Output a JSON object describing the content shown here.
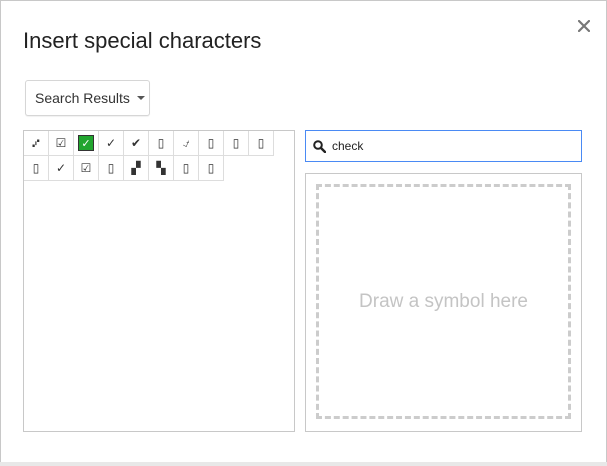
{
  "dialog": {
    "title": "Insert special characters",
    "close_icon": "close-icon"
  },
  "category_dropdown": {
    "selected": "Search Results"
  },
  "search": {
    "value": "check",
    "icon": "search-icon"
  },
  "results": [
    {
      "char": "⑇",
      "name": "partial-check-symbol"
    },
    {
      "char": "☑",
      "name": "ballot-box-with-check"
    },
    {
      "char": "✅",
      "name": "white-heavy-check-mark",
      "style": "green-box"
    },
    {
      "char": "✓",
      "name": "check-mark"
    },
    {
      "char": "✔",
      "name": "heavy-check-mark"
    },
    {
      "char": "▯",
      "name": "unknown-glyph"
    },
    {
      "char": "⍻",
      "name": "not-check-mark"
    },
    {
      "char": "▯",
      "name": "unknown-glyph"
    },
    {
      "char": "▯",
      "name": "unknown-glyph"
    },
    {
      "char": "▯",
      "name": "unknown-glyph"
    },
    {
      "char": "▯",
      "name": "unknown-glyph"
    },
    {
      "char": "✓",
      "name": "check-mark-light"
    },
    {
      "char": "☑",
      "name": "ballot-box-with-check"
    },
    {
      "char": "▯",
      "name": "unknown-glyph"
    },
    {
      "char": "▞",
      "name": "checkerboard-left"
    },
    {
      "char": "▚",
      "name": "checkerboard-right"
    },
    {
      "char": "▯",
      "name": "unknown-glyph"
    },
    {
      "char": "▯",
      "name": "unknown-glyph"
    }
  ],
  "draw_panel": {
    "hint": "Draw a symbol here"
  },
  "colors": {
    "accent_blue": "#4a8af4",
    "check_green": "#21a52f",
    "border_gray": "#c8c8c8"
  }
}
